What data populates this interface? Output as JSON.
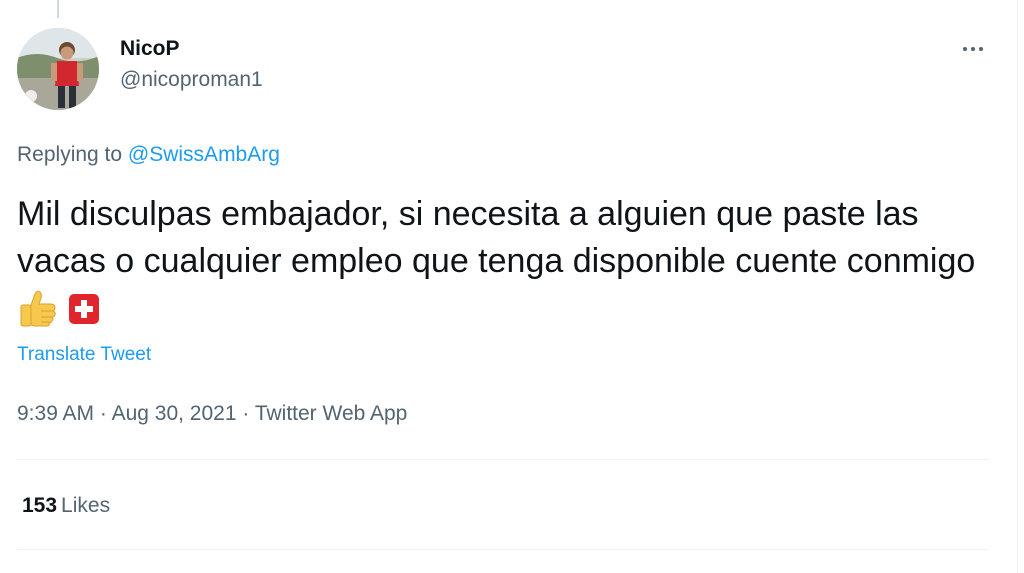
{
  "author": {
    "display_name": "NicoP",
    "handle": "@nicoproman1"
  },
  "reply": {
    "prefix": "Replying to ",
    "mention": "@SwissAmbArg"
  },
  "tweet": {
    "text": "Mil disculpas embajador, si necesita a alguien que paste las vacas o cualquier empleo que tenga disponible cuente conmigo",
    "emojis": [
      "thumbs-up-icon",
      "swiss-flag-icon"
    ],
    "translate_label": "Translate Tweet"
  },
  "meta": {
    "time": "9:39 AM",
    "separator": " · ",
    "date": "Aug 30, 2021",
    "app": "Twitter Web App"
  },
  "stats": {
    "likes_count": "153",
    "likes_label": "Likes"
  },
  "colors": {
    "link": "#1d9bf0",
    "secondary_text": "#536471",
    "primary_text": "#0f1419",
    "divider": "#eff3f4"
  }
}
